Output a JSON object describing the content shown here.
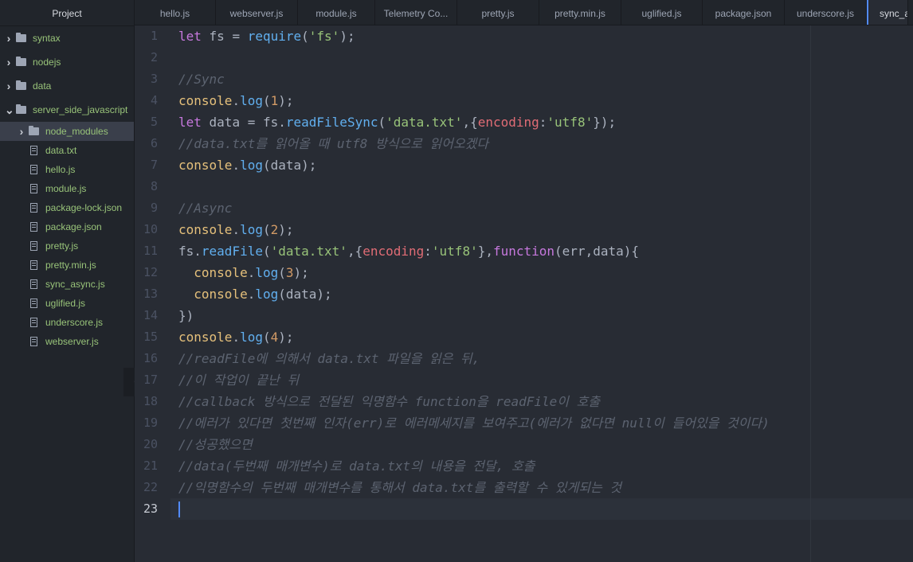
{
  "sidebar": {
    "title": "Project",
    "items": [
      {
        "label": "syntax",
        "type": "folder",
        "depth": 0,
        "expanded": false
      },
      {
        "label": "nodejs",
        "type": "folder",
        "depth": 0,
        "expanded": false
      },
      {
        "label": "data",
        "type": "folder",
        "depth": 0,
        "expanded": false
      },
      {
        "label": "server_side_javascript",
        "type": "folder",
        "depth": 0,
        "expanded": true
      },
      {
        "label": "node_modules",
        "type": "folder",
        "depth": 1,
        "expanded": false,
        "selected": true
      },
      {
        "label": "data.txt",
        "type": "file",
        "depth": 1
      },
      {
        "label": "hello.js",
        "type": "file",
        "depth": 1
      },
      {
        "label": "module.js",
        "type": "file",
        "depth": 1
      },
      {
        "label": "package-lock.json",
        "type": "file",
        "depth": 1
      },
      {
        "label": "package.json",
        "type": "file",
        "depth": 1
      },
      {
        "label": "pretty.js",
        "type": "file",
        "depth": 1
      },
      {
        "label": "pretty.min.js",
        "type": "file",
        "depth": 1
      },
      {
        "label": "sync_async.js",
        "type": "file",
        "depth": 1
      },
      {
        "label": "uglified.js",
        "type": "file",
        "depth": 1
      },
      {
        "label": "underscore.js",
        "type": "file",
        "depth": 1
      },
      {
        "label": "webserver.js",
        "type": "file",
        "depth": 1
      }
    ]
  },
  "tabs": [
    {
      "label": "hello.js"
    },
    {
      "label": "webserver.js"
    },
    {
      "label": "module.js"
    },
    {
      "label": "Telemetry Co..."
    },
    {
      "label": "pretty.js"
    },
    {
      "label": "pretty.min.js"
    },
    {
      "label": "uglified.js"
    },
    {
      "label": "package.json"
    },
    {
      "label": "underscore.js"
    },
    {
      "label": "sync_a",
      "active": true
    }
  ],
  "editor": {
    "current_line": 23,
    "lines": [
      [
        [
          "kw",
          "let"
        ],
        [
          "t",
          " fs = "
        ],
        [
          "fn",
          "require"
        ],
        [
          "t",
          "("
        ],
        [
          "str",
          "'fs'"
        ],
        [
          "t",
          ");"
        ]
      ],
      [],
      [
        [
          "cm",
          "//Sync"
        ]
      ],
      [
        [
          "obj",
          "console"
        ],
        [
          "t",
          "."
        ],
        [
          "fn",
          "log"
        ],
        [
          "t",
          "("
        ],
        [
          "num",
          "1"
        ],
        [
          "t",
          ");"
        ]
      ],
      [
        [
          "kw",
          "let"
        ],
        [
          "t",
          " data = fs."
        ],
        [
          "fn",
          "readFileSync"
        ],
        [
          "t",
          "("
        ],
        [
          "str",
          "'data.txt'"
        ],
        [
          "t",
          ",{"
        ],
        [
          "prop",
          "encoding"
        ],
        [
          "t",
          ":"
        ],
        [
          "str",
          "'utf8'"
        ],
        [
          "t",
          "});"
        ]
      ],
      [
        [
          "cm",
          "//data.txt를 읽어올 때 utf8 방식으로 읽어오겠다"
        ]
      ],
      [
        [
          "obj",
          "console"
        ],
        [
          "t",
          "."
        ],
        [
          "fn",
          "log"
        ],
        [
          "t",
          "(data);"
        ]
      ],
      [],
      [
        [
          "cm",
          "//Async"
        ]
      ],
      [
        [
          "obj",
          "console"
        ],
        [
          "t",
          "."
        ],
        [
          "fn",
          "log"
        ],
        [
          "t",
          "("
        ],
        [
          "num",
          "2"
        ],
        [
          "t",
          ");"
        ]
      ],
      [
        [
          "t",
          "fs."
        ],
        [
          "fn",
          "readFile"
        ],
        [
          "t",
          "("
        ],
        [
          "str",
          "'data.txt'"
        ],
        [
          "t",
          ",{"
        ],
        [
          "prop",
          "encoding"
        ],
        [
          "t",
          ":"
        ],
        [
          "str",
          "'utf8'"
        ],
        [
          "t",
          "},"
        ],
        [
          "kw",
          "function"
        ],
        [
          "t",
          "(err,data){"
        ]
      ],
      [
        [
          "t",
          "  "
        ],
        [
          "obj",
          "console"
        ],
        [
          "t",
          "."
        ],
        [
          "fn",
          "log"
        ],
        [
          "t",
          "("
        ],
        [
          "num",
          "3"
        ],
        [
          "t",
          ");"
        ]
      ],
      [
        [
          "t",
          "  "
        ],
        [
          "obj",
          "console"
        ],
        [
          "t",
          "."
        ],
        [
          "fn",
          "log"
        ],
        [
          "t",
          "(data);"
        ]
      ],
      [
        [
          "t",
          "})"
        ]
      ],
      [
        [
          "obj",
          "console"
        ],
        [
          "t",
          "."
        ],
        [
          "fn",
          "log"
        ],
        [
          "t",
          "("
        ],
        [
          "num",
          "4"
        ],
        [
          "t",
          ");"
        ]
      ],
      [
        [
          "cm",
          "//readFile에 의해서 data.txt 파일을 읽은 뒤,"
        ]
      ],
      [
        [
          "cm",
          "//이 작업이 끝난 뒤"
        ]
      ],
      [
        [
          "cm",
          "//callback 방식으로 전달된 익명함수 function을 readFile이 호출"
        ]
      ],
      [
        [
          "cm",
          "//에러가 있다면 첫번째 인자(err)로 에러메세지를 보여주고(에러가 없다면 null이 들어있을 것이다)"
        ]
      ],
      [
        [
          "cm",
          "//성공했으면"
        ]
      ],
      [
        [
          "cm",
          "//data(두번째 매개변수)로 data.txt의 내용을 전달, 호출"
        ]
      ],
      [
        [
          "cm",
          "//익명함수의 두번째 매개변수를 통해서 data.txt를 출력할 수 있게되는 것"
        ]
      ],
      []
    ]
  }
}
